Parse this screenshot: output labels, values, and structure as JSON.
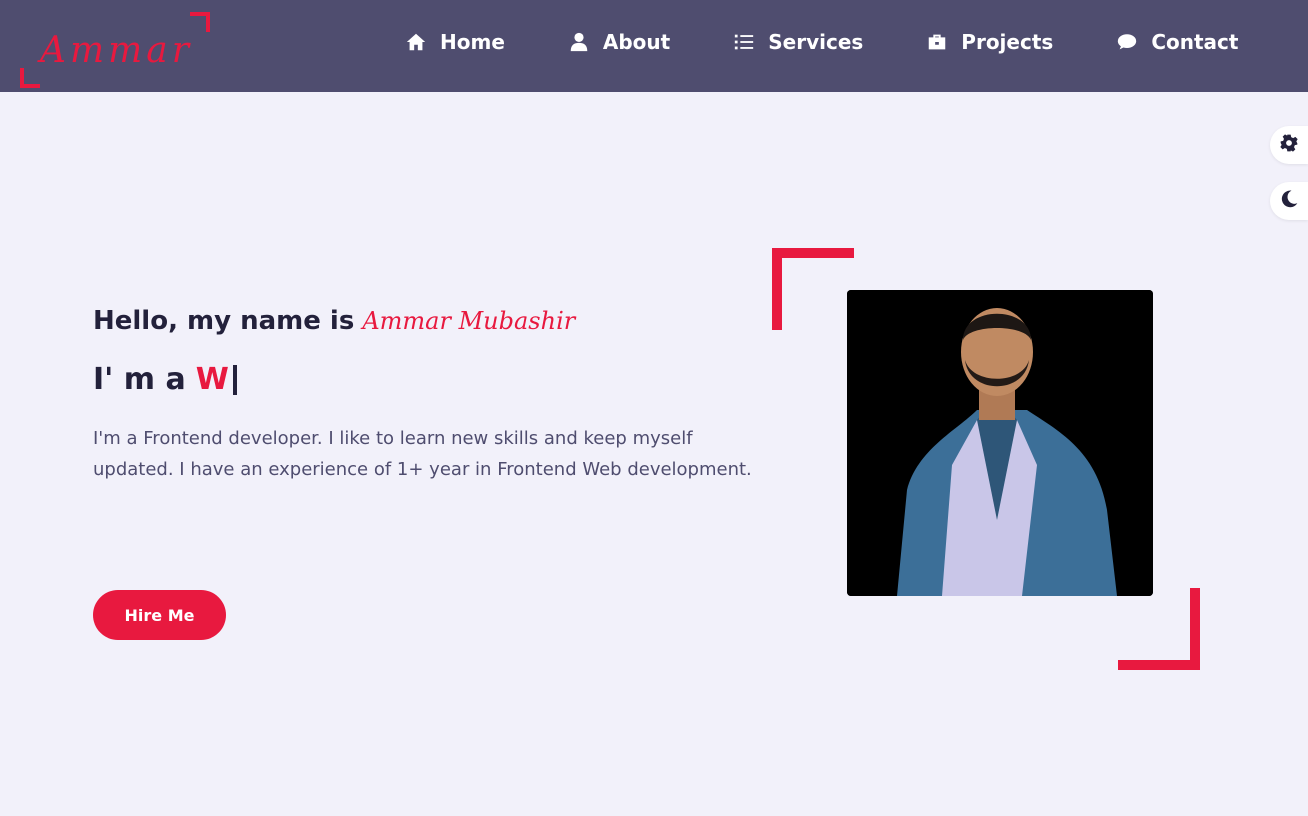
{
  "logo": {
    "text": "Ammar"
  },
  "nav": {
    "items": [
      {
        "label": "Home",
        "icon": "home-icon"
      },
      {
        "label": "About",
        "icon": "user-icon"
      },
      {
        "label": "Services",
        "icon": "list-icon"
      },
      {
        "label": "Projects",
        "icon": "briefcase-icon"
      },
      {
        "label": "Contact",
        "icon": "chat-icon"
      }
    ]
  },
  "side_controls": {
    "settings_icon": "gear-icon",
    "theme_icon": "moon-icon"
  },
  "hero": {
    "greeting": "Hello, my name is",
    "name": "Ammar Mubashir",
    "role_prefix": "I' m a",
    "role_typed": "W",
    "bio": "I'm a Frontend developer. I like to learn new skills and keep myself updated. I have an experience of 1+ year in Frontend Web development.",
    "button_label": "Hire Me"
  },
  "colors": {
    "nav_bg": "#4f4d6f",
    "accent": "#e8193f",
    "page_bg": "#f2f1fa",
    "heading": "#23213b",
    "body_text": "#4f4d6f"
  }
}
